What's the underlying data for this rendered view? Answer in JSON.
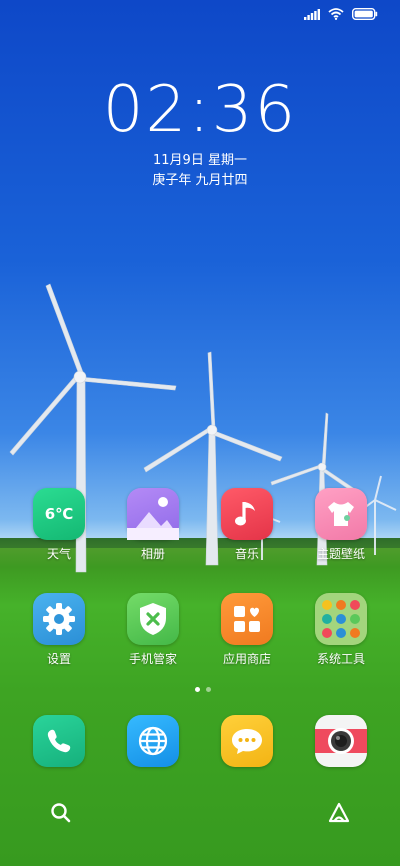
{
  "status": {
    "icons": [
      "signal-icon",
      "wifi-icon",
      "battery-icon"
    ]
  },
  "lockscreen": {
    "time": "02:36",
    "date": "11月9日 星期一",
    "lunar": "庚子年 九月廿四"
  },
  "apps_row1": [
    {
      "label": "天气",
      "icon": "weather-icon",
      "value": "6℃",
      "color": "#1ec882"
    },
    {
      "label": "相册",
      "icon": "gallery-icon",
      "color": "#a77cf0"
    },
    {
      "label": "音乐",
      "icon": "music-icon",
      "color": "#f04a5a"
    },
    {
      "label": "主题壁纸",
      "icon": "theme-icon",
      "color": "#f58bb4"
    }
  ],
  "apps_row2": [
    {
      "label": "设置",
      "icon": "gear-icon",
      "color": "#3aa0e0"
    },
    {
      "label": "手机管家",
      "icon": "shield-icon",
      "color": "#5ac85a"
    },
    {
      "label": "应用商店",
      "icon": "store-icon",
      "color": "#f58a2a"
    },
    {
      "label": "系统工具",
      "icon": "folder-icon",
      "color": "#9acd5a"
    }
  ],
  "dock": [
    {
      "name": "phone-app",
      "icon": "phone-icon",
      "color": "#20c08a"
    },
    {
      "name": "browser-app",
      "icon": "globe-icon",
      "color": "#1fa6f2"
    },
    {
      "name": "messages-app",
      "icon": "message-icon",
      "color": "#f6c21e"
    },
    {
      "name": "camera-app",
      "icon": "camera-icon",
      "color": "#f0f0f0"
    }
  ],
  "bottom": {
    "left": "search-icon",
    "right": "assistant-icon"
  },
  "pager": {
    "pages": 2,
    "current": 1
  }
}
